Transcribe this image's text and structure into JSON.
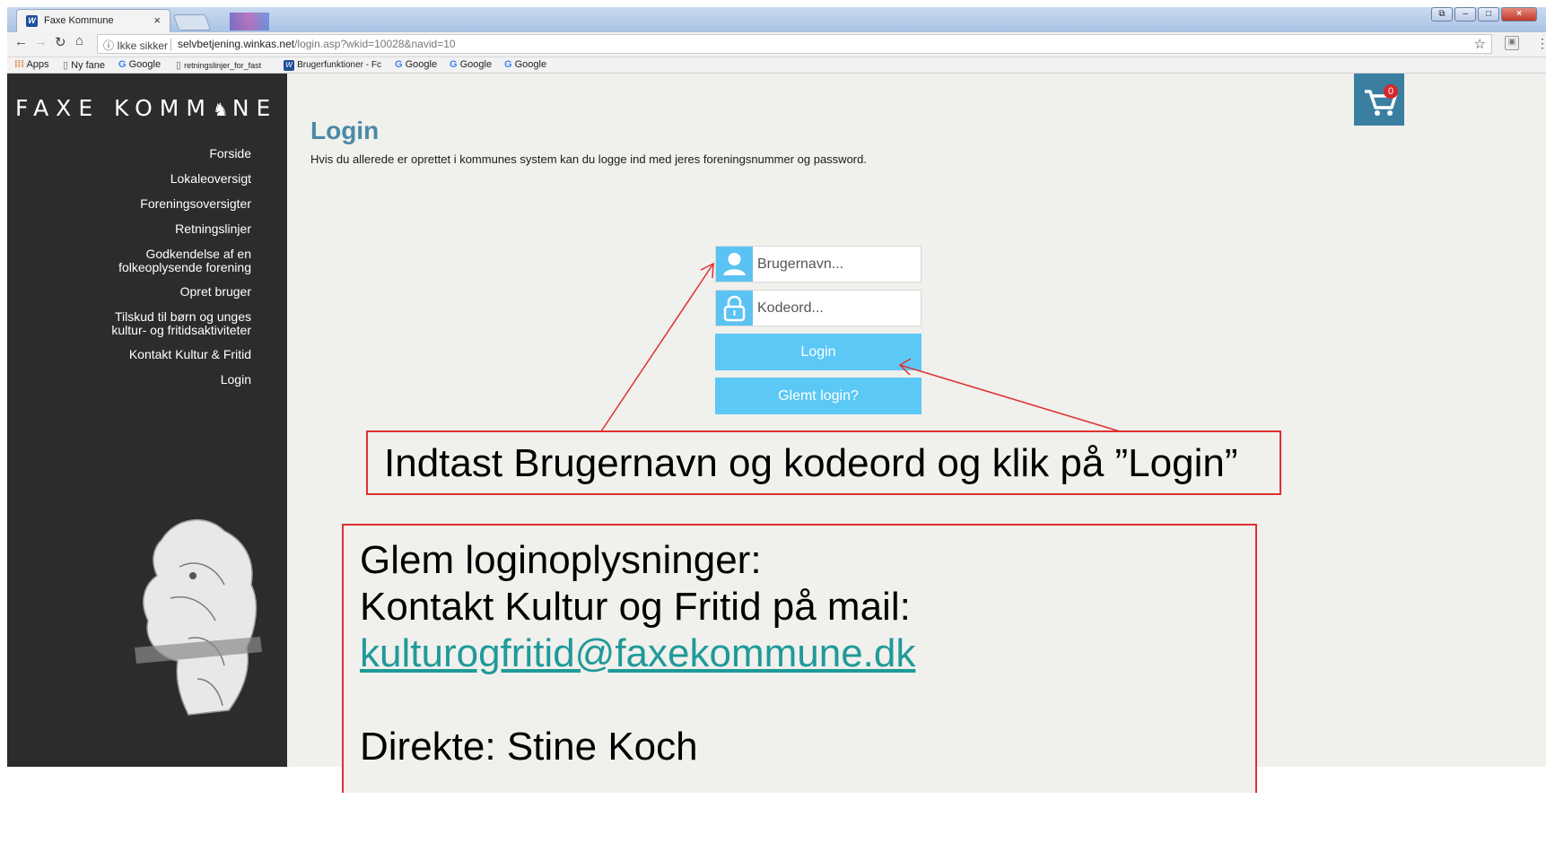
{
  "browser": {
    "tab_title": "Faxe Kommune",
    "tab_close": "×",
    "security_label": "ⓘ Ikke sikker",
    "url_host": "selvbetjening.winkas.net",
    "url_path": "/login.asp?wkid=10028&navid=10",
    "bookmarks": [
      {
        "icon": "apps",
        "label": "Apps"
      },
      {
        "icon": "page",
        "label": "Ny fane"
      },
      {
        "icon": "google",
        "label": "Google"
      },
      {
        "icon": "page",
        "label": "retningslinjer_for_fast"
      },
      {
        "icon": "winkas",
        "label": "Brugerfunktioner - Fc"
      },
      {
        "icon": "google",
        "label": "Google"
      },
      {
        "icon": "google",
        "label": "Google"
      },
      {
        "icon": "google",
        "label": "Google"
      }
    ]
  },
  "site": {
    "logo_text": "FAXE KOMM",
    "logo_text_end": "NE",
    "nav": [
      {
        "label": "Forside"
      },
      {
        "label": "Lokaleoversigt"
      },
      {
        "label": "Foreningsoversigter"
      },
      {
        "label": "Retningslinjer"
      },
      {
        "label": "Godkendelse af en",
        "label2": "folkeoplysende forening"
      },
      {
        "label": "Opret bruger"
      },
      {
        "label": "Tilskud til børn og unges",
        "label2": "kultur- og fritidsaktiviteter"
      },
      {
        "label": "Kontakt Kultur & Fritid"
      },
      {
        "label": "Login"
      }
    ],
    "cart_count": "0",
    "accent_color": "#5bc8f6",
    "sidebar_color": "#2c2c2c"
  },
  "login": {
    "title": "Login",
    "intro": "Hvis du allerede er oprettet i kommunes system kan du logge ind med jeres foreningsnummer og password.",
    "username_placeholder": "Brugernavn...",
    "password_placeholder": "Kodeord...",
    "login_button": "Login",
    "forgot_button": "Glemt login?"
  },
  "annotations": {
    "callout_1": "Indtast Brugernavn og kodeord og klik på ”Login”",
    "callout_2_line1": "Glem loginoplysninger:",
    "callout_2_line2": "Kontakt Kultur og Fritid på mail:",
    "callout_2_email": "kulturogfritid@faxekommune.dk",
    "callout_2_line4": "Direkte: Stine Koch"
  }
}
